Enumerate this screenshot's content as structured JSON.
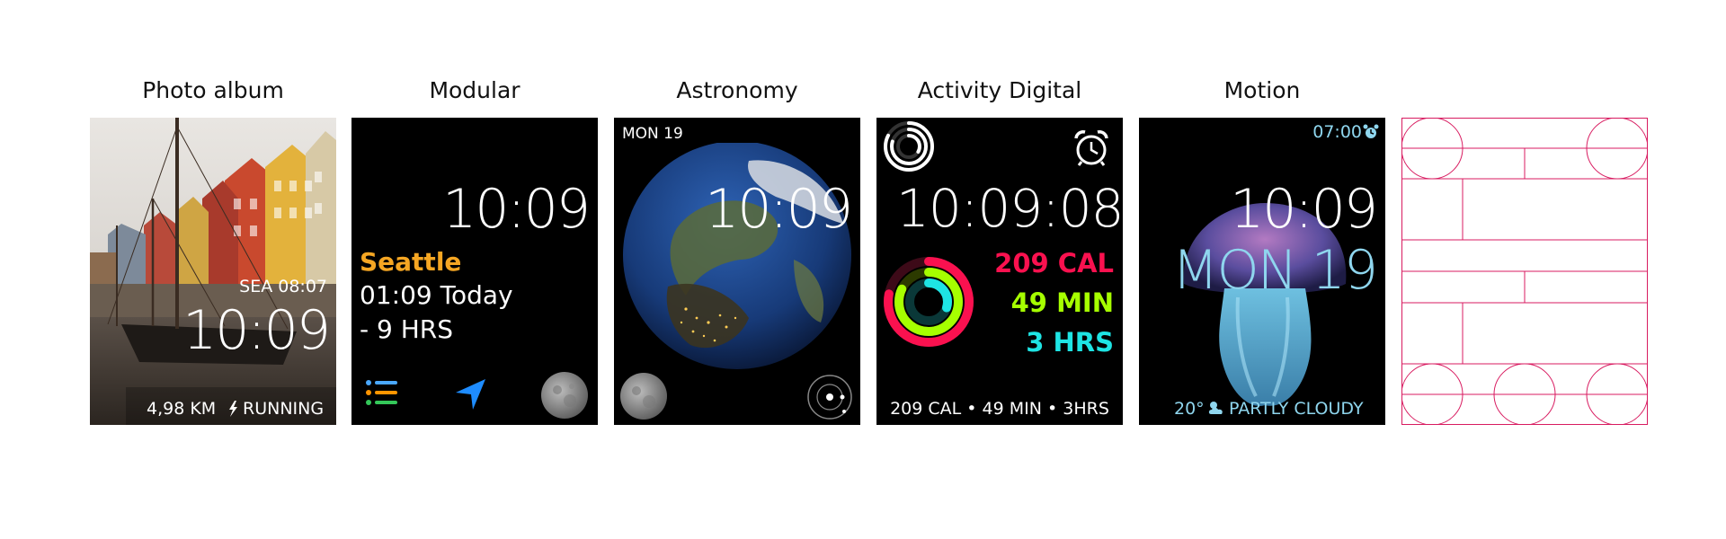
{
  "faces": {
    "photo": {
      "title": "Photo album",
      "location_time": "SEA 08:07",
      "time": "10:09",
      "activity": "4,98 KM",
      "activity_icon": "running-icon",
      "activity_label": "RUNNING"
    },
    "modular": {
      "title": "Modular",
      "time": "10:09",
      "city": "Seattle",
      "city_color": "#f5a623",
      "world_time": "01:09 Today",
      "offset": "- 9 HRS",
      "complications": [
        "list-icon",
        "navigation-arrow-icon",
        "moon-icon"
      ]
    },
    "astronomy": {
      "title": "Astronomy",
      "date": "MON 19",
      "time": "10:09",
      "complications": [
        "moon-icon",
        "solar-system-icon"
      ]
    },
    "activity": {
      "title": "Activity Digital",
      "time": "10:09:08",
      "calories": "209 CAL",
      "minutes": "49 MIN",
      "hours": "3 HRS",
      "summary": "209 CAL • 49 MIN • 3HRS",
      "move_progress": 0.78,
      "exercise_progress": 0.82,
      "stand_progress": 0.3,
      "colors": {
        "move": "#fa114f",
        "exercise": "#a6ff00",
        "stand": "#1ee4e4"
      },
      "complications": [
        "activity-rings-icon",
        "alarm-clock-icon"
      ]
    },
    "motion": {
      "title": "Motion",
      "alarm": "07:00",
      "time": "10:09",
      "date": "MON 19",
      "weather": "20°",
      "weather_icon": "partly-cloudy-icon",
      "weather_label": "PARTLY CLOUDY",
      "accent": "#8fd6ee"
    },
    "layout": {
      "title": "",
      "line_color": "#d81b60"
    }
  }
}
